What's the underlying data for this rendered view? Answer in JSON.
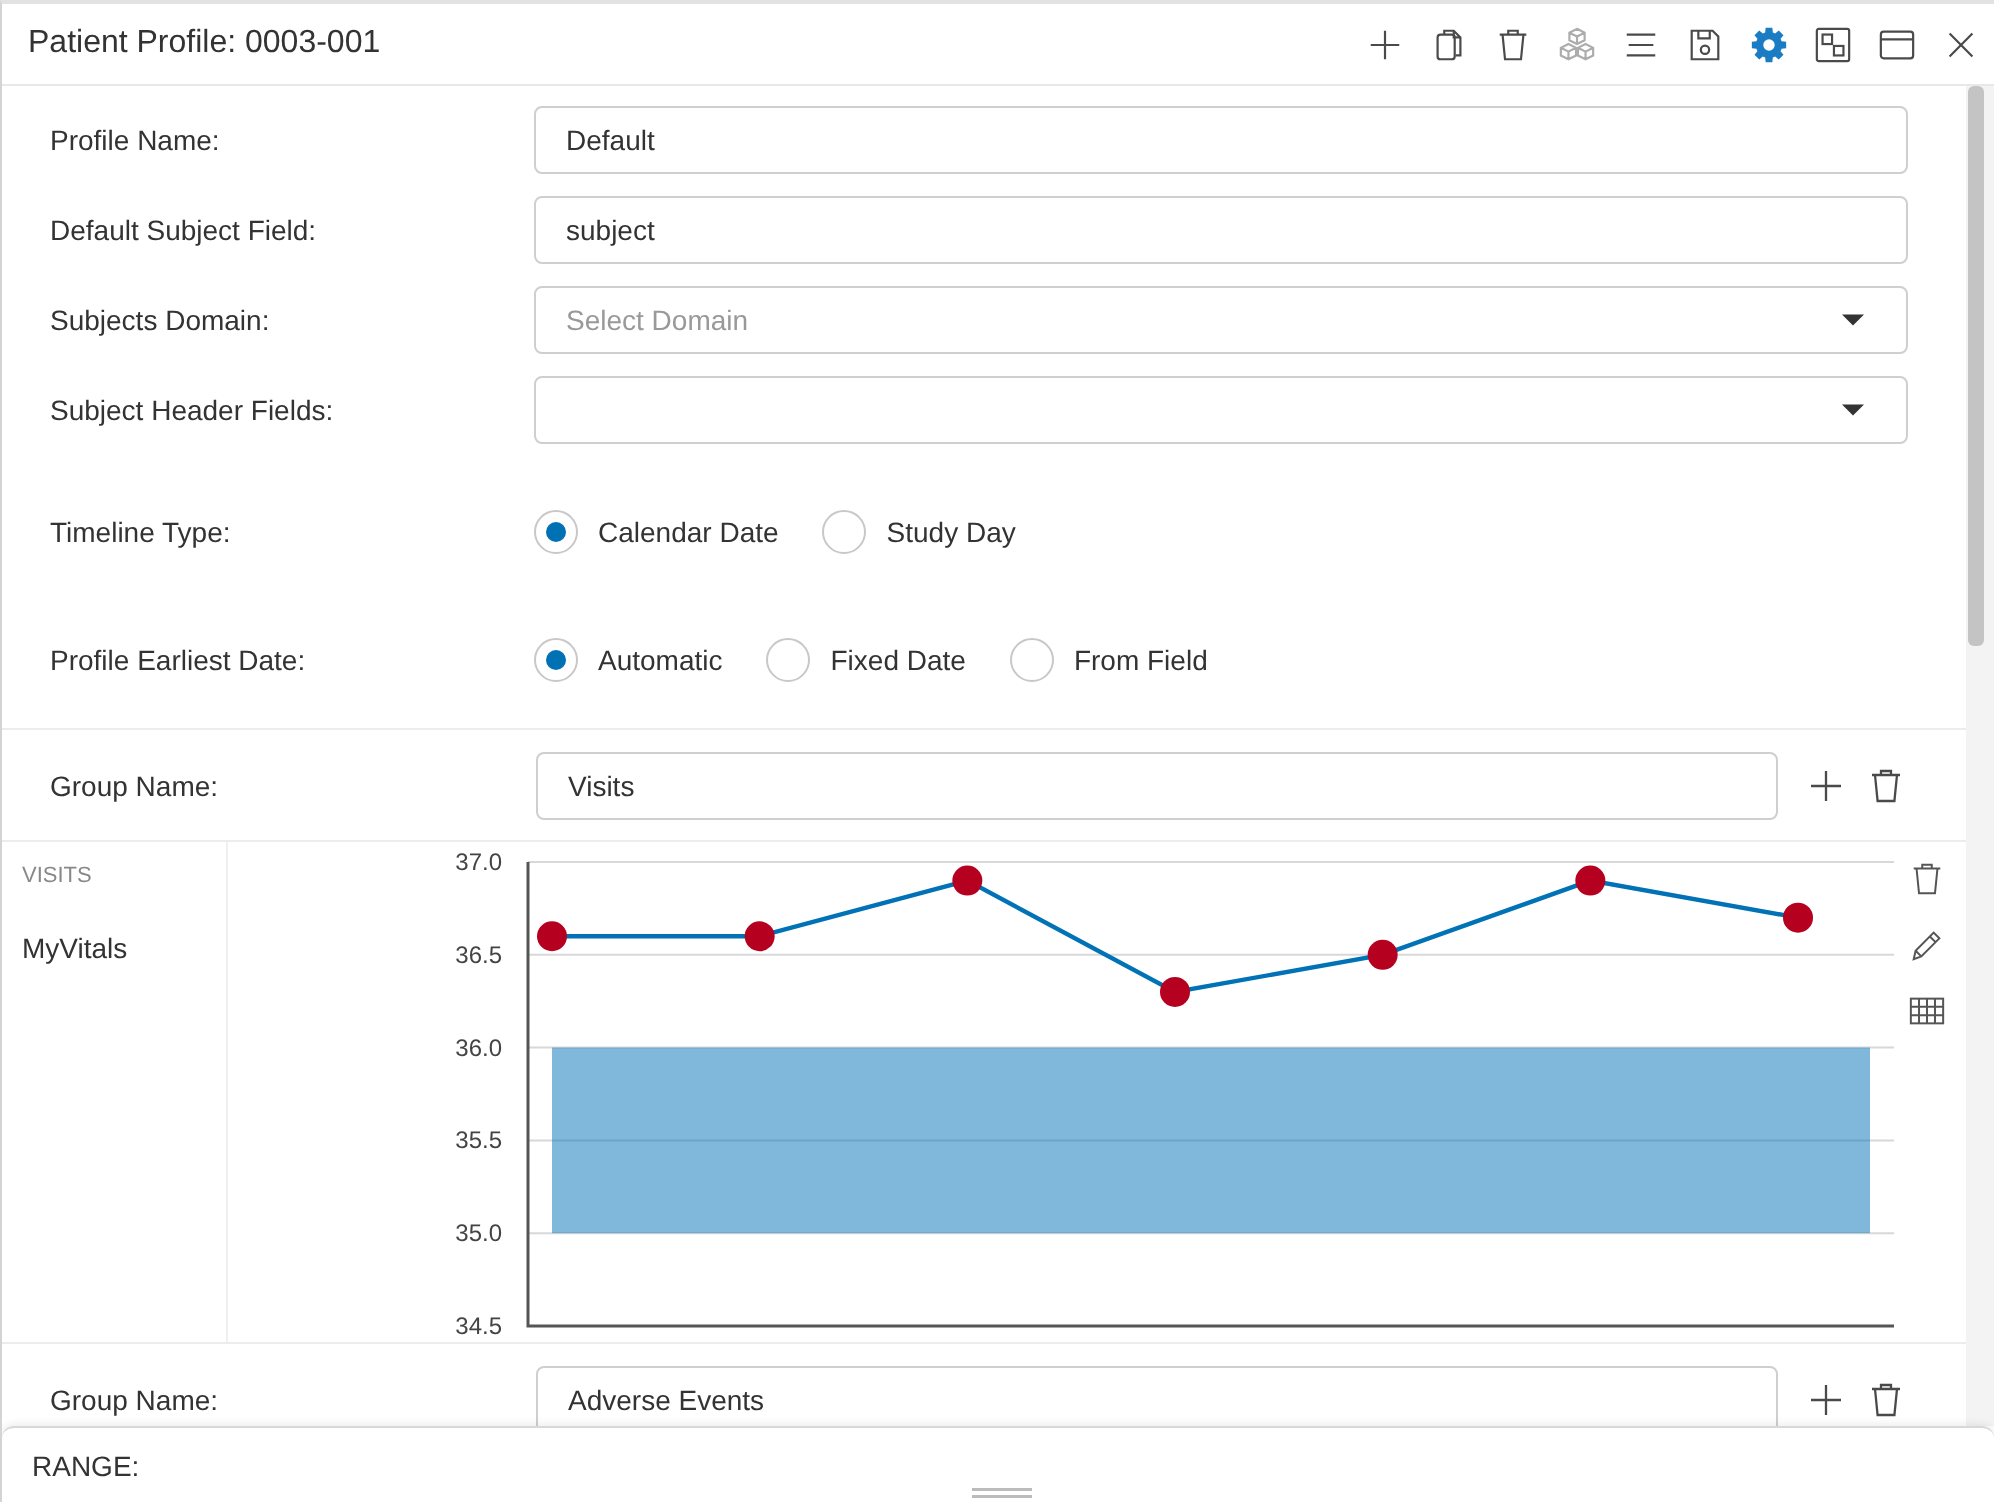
{
  "window": {
    "title": "Patient Profile: 0003-001"
  },
  "toolbar": [
    {
      "kind": "add",
      "selected": false,
      "disabled": false
    },
    {
      "kind": "copy",
      "selected": false,
      "disabled": false
    },
    {
      "kind": "delete",
      "selected": false,
      "disabled": false
    },
    {
      "kind": "cubes",
      "selected": false,
      "disabled": true
    },
    {
      "kind": "menu",
      "selected": false,
      "disabled": false
    },
    {
      "kind": "save",
      "selected": false,
      "disabled": false
    },
    {
      "kind": "settings",
      "selected": true,
      "disabled": false
    },
    {
      "kind": "layout",
      "selected": false,
      "disabled": false
    },
    {
      "kind": "window",
      "selected": false,
      "disabled": false
    },
    {
      "kind": "close",
      "selected": false,
      "disabled": false
    }
  ],
  "form": {
    "fields": [
      {
        "kind": "text",
        "label": "Profile Name:",
        "value": "Default"
      },
      {
        "kind": "text",
        "label": "Default Subject Field:",
        "value": "subject"
      },
      {
        "kind": "select",
        "label": "Subjects Domain:",
        "placeholder": "Select Domain"
      },
      {
        "kind": "select",
        "label": "Subject Header Fields:"
      },
      {
        "kind": "radio",
        "label": "Timeline Type:",
        "options": [
          {
            "label": "Calendar Date",
            "selected": true
          },
          {
            "label": "Study Day",
            "selected": false
          }
        ]
      },
      {
        "kind": "radio",
        "label": "Profile Earliest Date:",
        "options": [
          {
            "label": "Automatic",
            "selected": true
          },
          {
            "label": "Fixed Date",
            "selected": false
          },
          {
            "label": "From Field",
            "selected": false
          }
        ]
      }
    ]
  },
  "groups": [
    {
      "label": "Group Name:",
      "value": "Visits",
      "heading": "VISITS",
      "tracks": [
        {
          "label": "MyVitals",
          "chart_data": {
            "type": "line",
            "categories": [
              null,
              null,
              null,
              null,
              null,
              null,
              null
            ],
            "series": [
              {
                "color": "#0072b5",
                "marker": "o",
                "values": [
                  36.6,
                  36.6,
                  36.9,
                  36.3,
                  36.5,
                  36.9,
                  36.7
                ]
              }
            ],
            "ylim": [
              34.5,
              37.0
            ],
            "yticks": [
              {
                "value": 34.5,
                "label": "34.5"
              },
              {
                "value": 35.0,
                "label": "35.0"
              },
              {
                "value": 35.5,
                "label": "35.5"
              },
              {
                "value": 36.0,
                "label": "36.0"
              },
              {
                "value": 36.5,
                "label": "36.5"
              },
              {
                "value": 37.0,
                "label": "37.0"
              }
            ],
            "grid": true,
            "bands": [
              {
                "axis": "y",
                "from": 35.0,
                "to": 36.0
              }
            ]
          }
        }
      ]
    },
    {
      "label": "Group Name:",
      "value": "Adverse Events"
    }
  ],
  "bottom_panel": {
    "label": "RANGE:"
  }
}
